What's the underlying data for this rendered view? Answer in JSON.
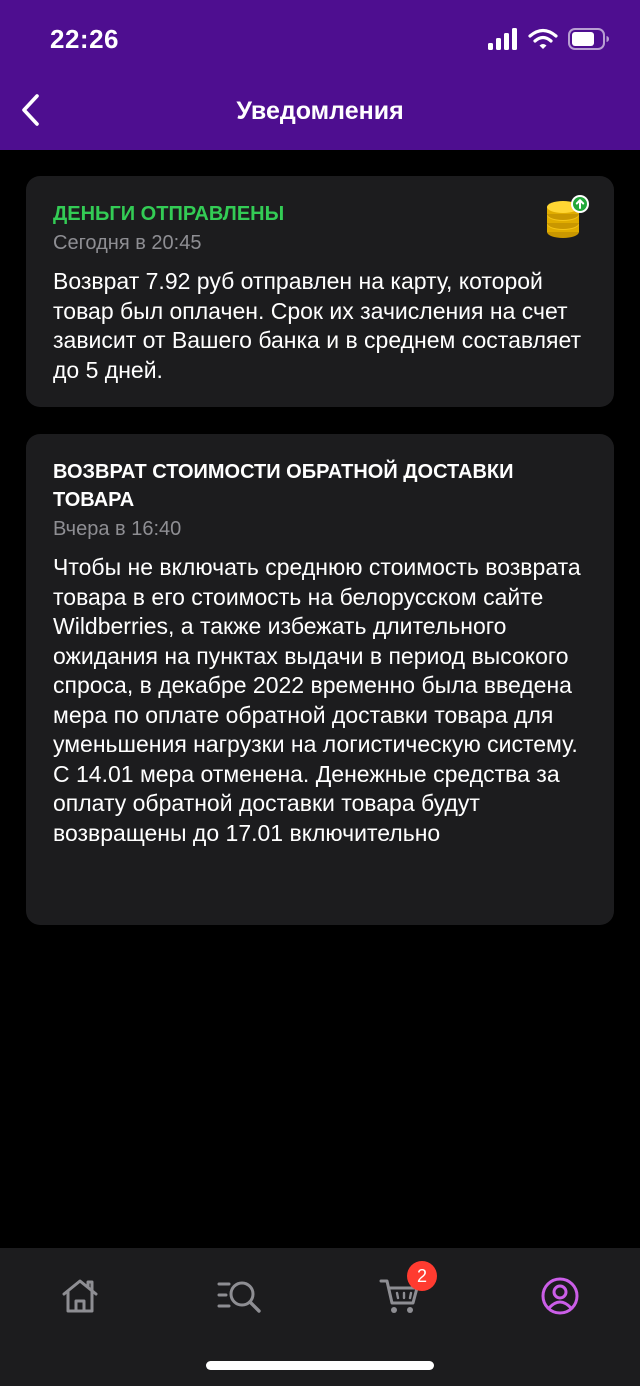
{
  "status_bar": {
    "time": "22:26"
  },
  "header": {
    "title": "Уведомления"
  },
  "notifications": [
    {
      "title": "ДЕНЬГИ ОТПРАВЛЕНЫ",
      "date": "Сегодня в 20:45",
      "body": "Возврат 7.92 руб отправлен на карту, которой товар был оплачен. Срок их зачисления на счет зависит от Вашего банка и в среднем составляет до 5 дней.",
      "icon": "coins-icon"
    },
    {
      "title": "ВОЗВРАТ СТОИМОСТИ ОБРАТНОЙ ДОСТАВКИ ТОВАРА",
      "date": "Вчера в 16:40",
      "body": "Чтобы не включать среднюю стоимость возврата товара в его стоимость на белорусском сайте Wildberries, а также избежать длительного ожидания на пунктах выдачи в период высокого спроса, в декабре 2022 временно была введена мера по оплате обратной доставки товара для уменьшения нагрузки на логистическую систему. С 14.01 мера отменена. Денежные средства за оплату обратной доставки товара будут возвращены до 17.01 включительно"
    }
  ],
  "tab_bar": {
    "cart_badge": "2",
    "tabs": [
      "home-icon",
      "search-icon",
      "cart-icon",
      "profile-icon"
    ]
  },
  "colors": {
    "header_bg": "#4e0e90",
    "card_bg": "#1c1c1e",
    "accent_green": "#33cc55",
    "active_tab": "#cb5ee8",
    "badge_red": "#ff3b30"
  }
}
